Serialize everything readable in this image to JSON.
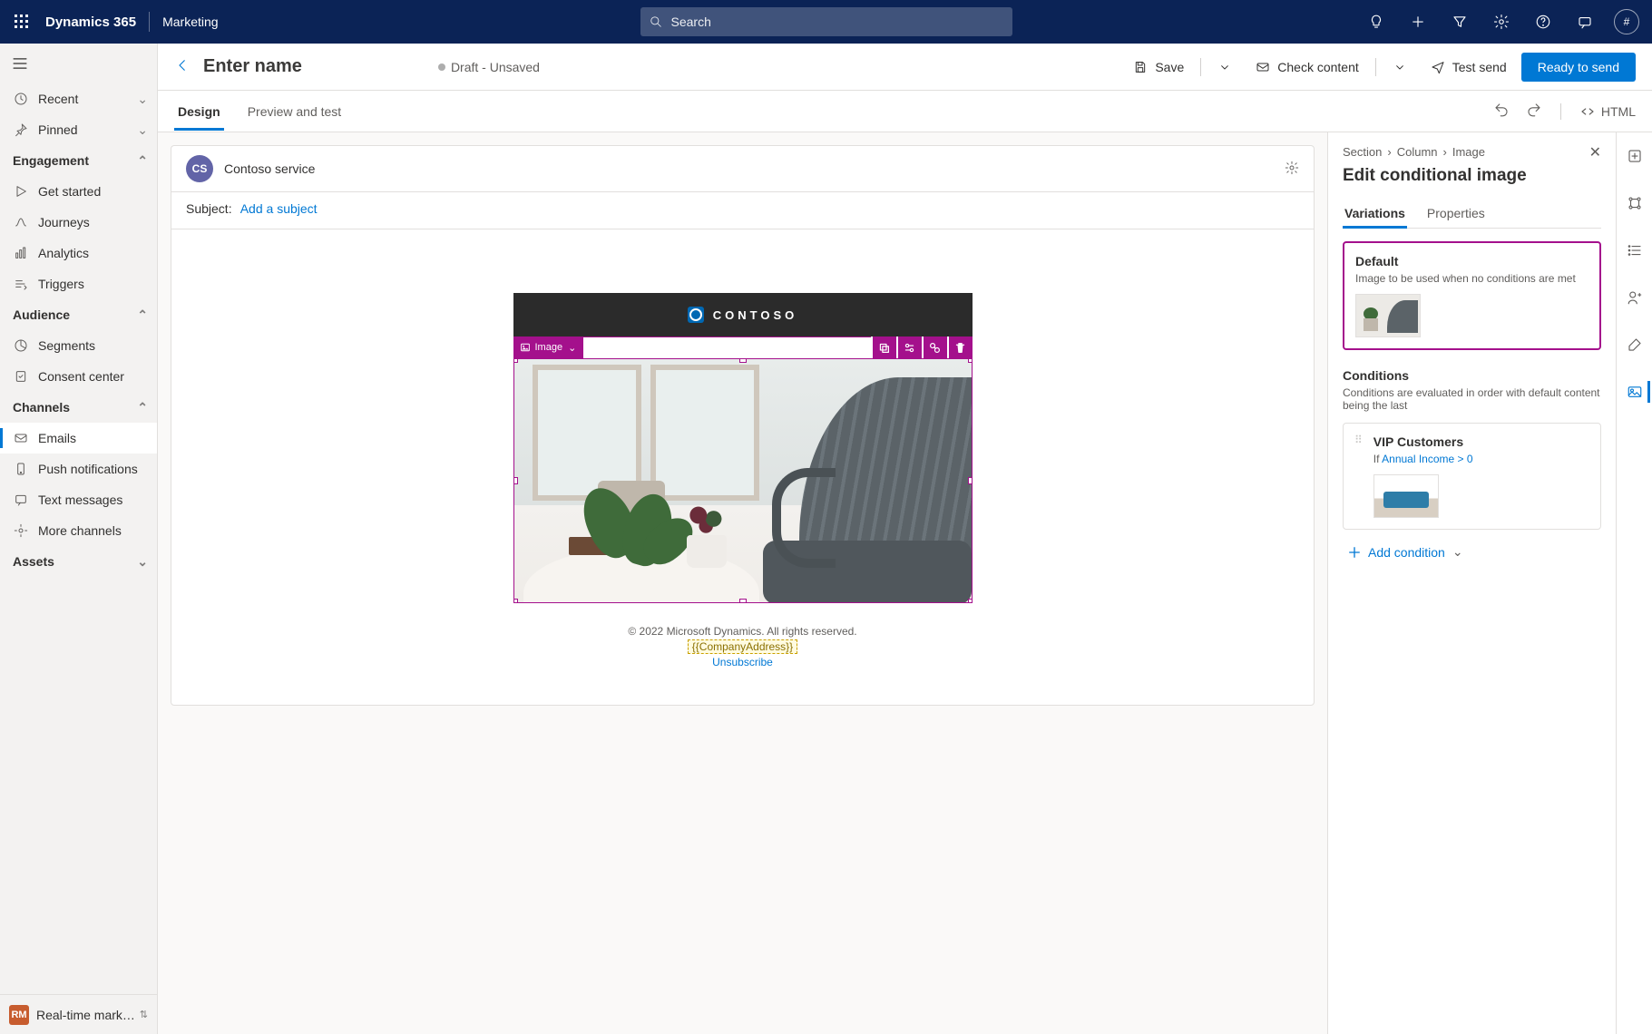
{
  "topbar": {
    "brand": "Dynamics 365",
    "module": "Marketing",
    "search_placeholder": "Search"
  },
  "sidebar": {
    "recent": "Recent",
    "pinned": "Pinned",
    "engagement": "Engagement",
    "get_started": "Get started",
    "journeys": "Journeys",
    "analytics": "Analytics",
    "triggers": "Triggers",
    "audience": "Audience",
    "segments": "Segments",
    "consent_center": "Consent center",
    "channels": "Channels",
    "emails": "Emails",
    "push": "Push notifications",
    "text": "Text messages",
    "more_channels": "More channels",
    "assets": "Assets",
    "footer_badge": "RM",
    "footer_label": "Real-time marketi..."
  },
  "cmdbar": {
    "title": "Enter name",
    "status": "Draft - Unsaved",
    "save": "Save",
    "check": "Check content",
    "test": "Test send",
    "ready": "Ready to send"
  },
  "tabs": {
    "design": "Design",
    "preview": "Preview and test",
    "html": "HTML"
  },
  "canvas": {
    "avatar": "CS",
    "sender": "Contoso service",
    "subject_label": "Subject:",
    "subject_link": "Add a subject",
    "brand": "CONTOSO",
    "image_tag": "Image",
    "copyright": "© 2022 Microsoft Dynamics. All rights reserved.",
    "address": "{{CompanyAddress}}",
    "unsubscribe": "Unsubscribe"
  },
  "panel": {
    "crumb1": "Section",
    "crumb2": "Column",
    "crumb3": "Image",
    "title": "Edit conditional image",
    "tab_variations": "Variations",
    "tab_properties": "Properties",
    "default_title": "Default",
    "default_sub": "Image to be used when no conditions are met",
    "conditions_h": "Conditions",
    "conditions_sub": "Conditions are evaluated in order with default content being the last",
    "cond1_title": "VIP Customers",
    "cond1_if": "If ",
    "cond1_field": "Annual Income > 0",
    "add": "Add condition"
  }
}
